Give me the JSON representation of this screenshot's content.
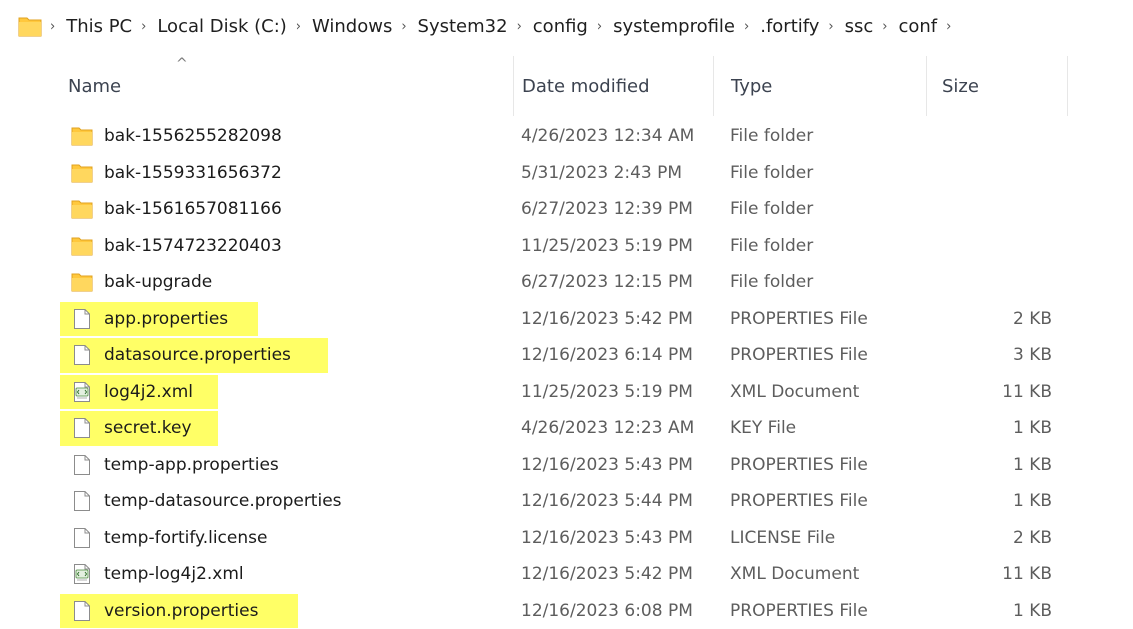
{
  "address": {
    "folder_icon": "folder-icon",
    "separator": "›",
    "crumbs": [
      "This PC",
      "Local Disk (C:)",
      "Windows",
      "System32",
      "config",
      "systemprofile",
      ".fortify",
      "ssc",
      "conf"
    ]
  },
  "columns": {
    "name": "Name",
    "date": "Date modified",
    "type": "Type",
    "size": "Size",
    "sort_indicator": "^"
  },
  "colors": {
    "folder": "#ffc83d",
    "highlight": "#ffff66",
    "text_secondary": "#5d5d5d"
  },
  "files": [
    {
      "name": "bak-1556255282098",
      "date": "4/26/2023 12:34 AM",
      "type": "File folder",
      "size": "",
      "icon": "folder-icon",
      "highlighted": false
    },
    {
      "name": "bak-1559331656372",
      "date": "5/31/2023 2:43 PM",
      "type": "File folder",
      "size": "",
      "icon": "folder-icon",
      "highlighted": false
    },
    {
      "name": "bak-1561657081166",
      "date": "6/27/2023 12:39 PM",
      "type": "File folder",
      "size": "",
      "icon": "folder-icon",
      "highlighted": false
    },
    {
      "name": "bak-1574723220403",
      "date": "11/25/2023 5:19 PM",
      "type": "File folder",
      "size": "",
      "icon": "folder-icon",
      "highlighted": false
    },
    {
      "name": "bak-upgrade",
      "date": "6/27/2023 12:15 PM",
      "type": "File folder",
      "size": "",
      "icon": "folder-icon",
      "highlighted": false
    },
    {
      "name": "app.properties",
      "date": "12/16/2023 5:42 PM",
      "type": "PROPERTIES File",
      "size": "2 KB",
      "icon": "file-icon",
      "highlighted": true
    },
    {
      "name": "datasource.properties",
      "date": "12/16/2023 6:14 PM",
      "type": "PROPERTIES File",
      "size": "3 KB",
      "icon": "file-icon",
      "highlighted": true
    },
    {
      "name": "log4j2.xml",
      "date": "11/25/2023 5:19 PM",
      "type": "XML Document",
      "size": "11 KB",
      "icon": "xml-file-icon",
      "highlighted": true
    },
    {
      "name": "secret.key",
      "date": "4/26/2023 12:23 AM",
      "type": "KEY File",
      "size": "1 KB",
      "icon": "file-icon",
      "highlighted": true
    },
    {
      "name": "temp-app.properties",
      "date": "12/16/2023 5:43 PM",
      "type": "PROPERTIES File",
      "size": "1 KB",
      "icon": "file-icon",
      "highlighted": false
    },
    {
      "name": "temp-datasource.properties",
      "date": "12/16/2023 5:44 PM",
      "type": "PROPERTIES File",
      "size": "1 KB",
      "icon": "file-icon",
      "highlighted": false
    },
    {
      "name": "temp-fortify.license",
      "date": "12/16/2023 5:43 PM",
      "type": "LICENSE File",
      "size": "2 KB",
      "icon": "file-icon",
      "highlighted": false
    },
    {
      "name": "temp-log4j2.xml",
      "date": "12/16/2023 5:42 PM",
      "type": "XML Document",
      "size": "11 KB",
      "icon": "xml-file-icon",
      "highlighted": false
    },
    {
      "name": "version.properties",
      "date": "12/16/2023 6:08 PM",
      "type": "PROPERTIES File",
      "size": "1 KB",
      "icon": "file-icon",
      "highlighted": true
    }
  ]
}
